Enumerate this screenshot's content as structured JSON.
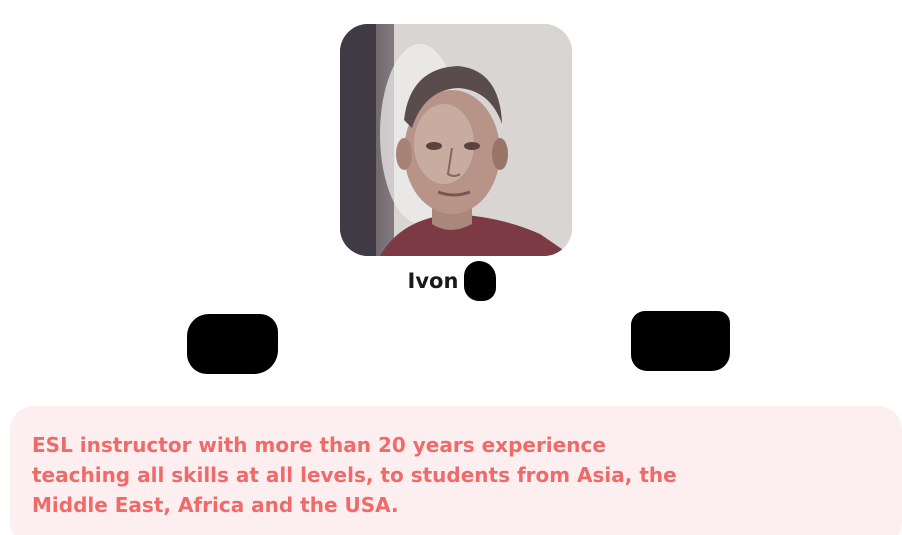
{
  "profile": {
    "name": "Ivon",
    "bio": "ESL instructor with more than 20 years experience teaching all skills at all levels, to students from Asia, the Middle East, Africa and the USA."
  },
  "colors": {
    "bio_background": "#fdeff0",
    "bio_text": "#f06a6a",
    "name_text": "#1a1a1a",
    "redaction": "#000000"
  }
}
